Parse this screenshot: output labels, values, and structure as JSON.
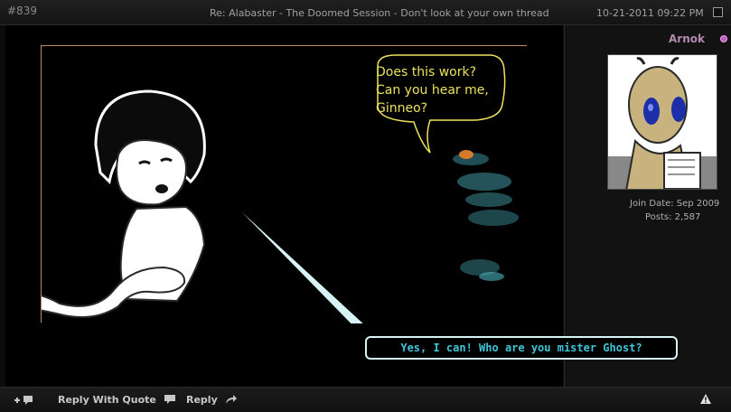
{
  "header": {
    "post_number": "#839",
    "thread_title": "Re: Alabaster - The Doomed Session - Don't look at your own thread",
    "date": "10-21-2011 09:22 PM"
  },
  "user": {
    "name": "Arnok",
    "join_date": "Join Date: Sep 2009",
    "posts": "Posts: 2,587"
  },
  "comic": {
    "speech_top": [
      "Does this work?",
      "Can you hear me,",
      "Ginneo?"
    ],
    "speech_bottom": "Yes, I can! Who are you mister Ghost?"
  },
  "footer": {
    "reply_label": "Reply",
    "reply_quote_label": "Reply With Quote"
  },
  "colors": {
    "accent_user": "#b48ab3",
    "speech_yellow": "#ece25c",
    "speech_cyan": "#3fc6d9",
    "frame_border": "#b98c63"
  }
}
